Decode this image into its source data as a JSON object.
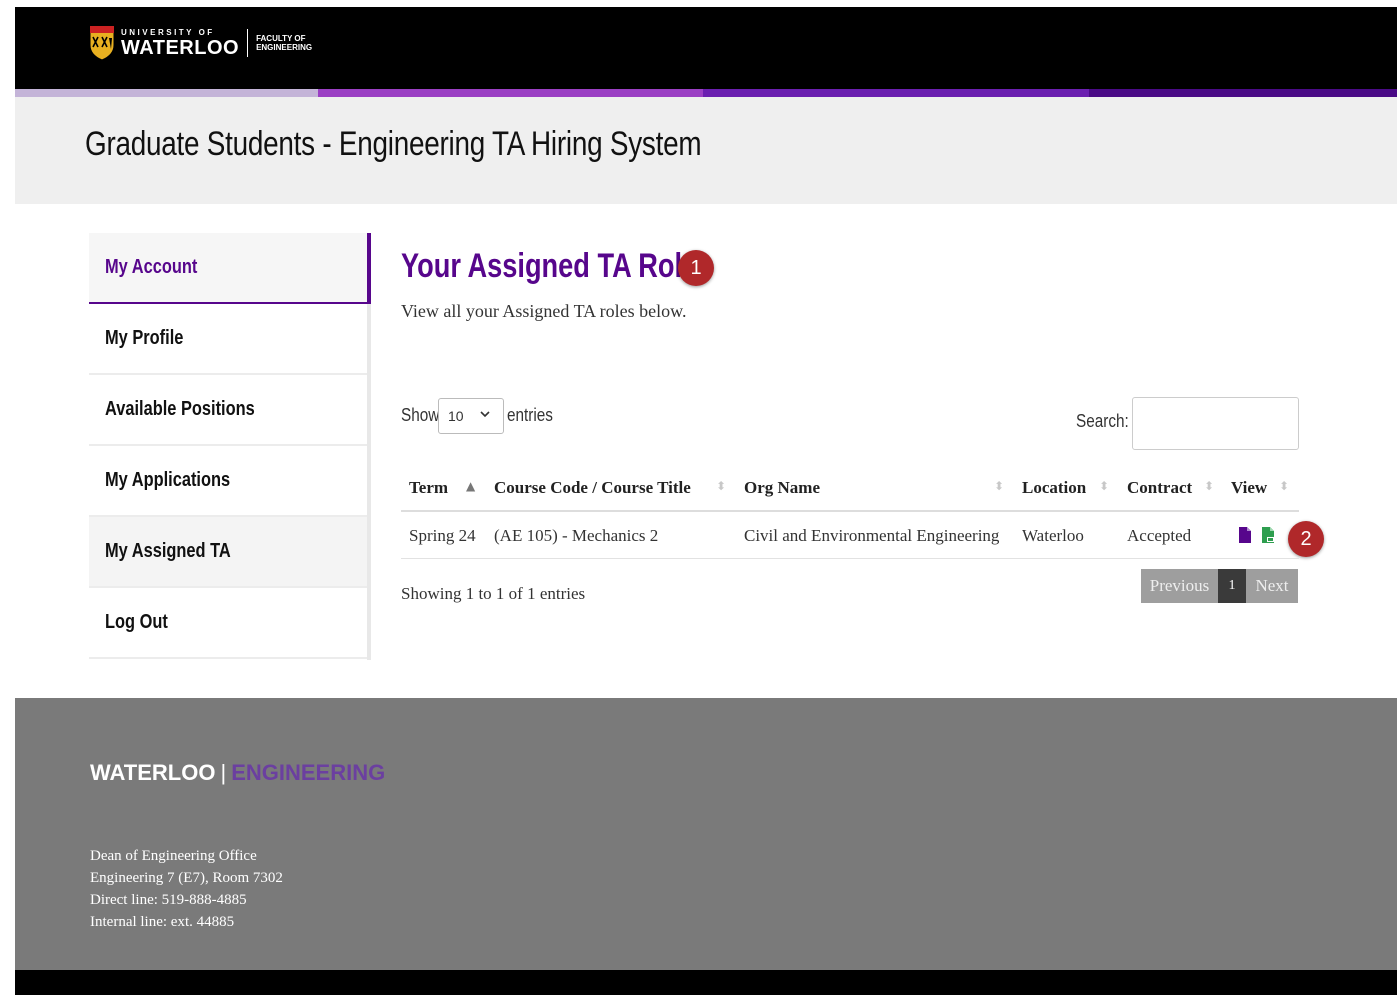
{
  "header": {
    "logo_small": "UNIVERSITY OF",
    "logo_big": "WATERLOO",
    "faculty_line1": "FACULTY OF",
    "faculty_line2": "ENGINEERING",
    "stripe_colors": [
      "#c4b4d8",
      "#9b3fc4",
      "#6b1fb0",
      "#4a0a86"
    ]
  },
  "banner": {
    "title": "Graduate Students - Engineering TA Hiring System"
  },
  "sidebar": {
    "items": [
      {
        "label": "My Account"
      },
      {
        "label": "My Profile"
      },
      {
        "label": "Available Positions"
      },
      {
        "label": "My Applications"
      },
      {
        "label": "My Assigned TA"
      },
      {
        "label": "Log Out"
      }
    ]
  },
  "main": {
    "title": "Your Assigned TA Roles",
    "subtitle": "View all your Assigned TA roles below.",
    "annotation_badges": [
      "1",
      "2"
    ]
  },
  "table_controls": {
    "show_label": "Show",
    "entries_value": "10",
    "entries_label": "entries",
    "search_label": "Search:"
  },
  "table": {
    "columns": [
      "Term",
      "Course Code / Course Title",
      "Org Name",
      "Location",
      "Contract",
      "View"
    ],
    "rows": [
      {
        "term": "Spring 24",
        "course": "(AE 105) - Mechanics 2",
        "org": "Civil and Environmental Engineering",
        "location": "Waterloo",
        "contract": "Accepted",
        "view_icons": [
          "document-icon",
          "pdf-document-icon"
        ]
      }
    ]
  },
  "pagination": {
    "summary": "Showing 1 to 1 of 1 entries",
    "previous": "Previous",
    "page": "1",
    "next": "Next"
  },
  "footer": {
    "brand_left": "WATERLOO",
    "brand_sep": "|",
    "brand_right": "ENGINEERING",
    "address": [
      "Dean of Engineering Office",
      "Engineering 7 (E7), Room 7302",
      "Direct line: 519-888-4885",
      "Internal line: ext. 44885"
    ]
  },
  "colors": {
    "accent": "#57068c",
    "badge": "#b0282a",
    "footer_bg": "#7a7a7a",
    "pdf_icon": "#2e9e4f"
  }
}
